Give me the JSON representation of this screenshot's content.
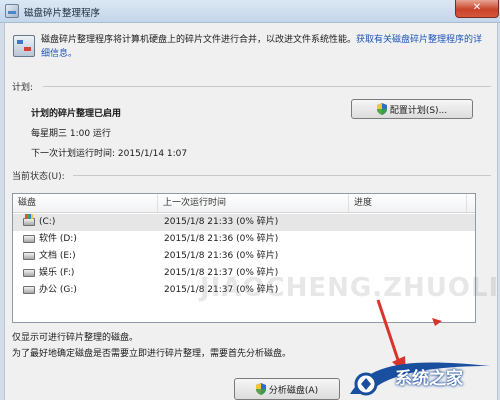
{
  "window": {
    "title": "磁盘碎片整理程序",
    "close_glyph": "✕"
  },
  "description": {
    "text": "磁盘碎片整理程序将计算机硬盘上的碎片文件进行合并，以改进文件系统性能。",
    "link_text": "获取有关磁盘碎片整理程序的详细信息。"
  },
  "schedule": {
    "section_label": "计划:",
    "status": "计划的碎片整理已启用",
    "run_time": "每星期三  1:00 运行",
    "next_run": "下一次计划运行时间: 2015/1/14 1:07",
    "configure_button": "配置计划(S)..."
  },
  "current_status": {
    "section_label": "当前状态(U):",
    "columns": [
      "磁盘",
      "上一次运行时间",
      "进度"
    ],
    "rows": [
      {
        "disk": "(C:)",
        "last_run": "2015/1/8 21:33 (0% 碎片)",
        "progress": "",
        "icon": "system-drive-icon"
      },
      {
        "disk": "软件 (D:)",
        "last_run": "2015/1/8 21:36 (0% 碎片)",
        "progress": "",
        "icon": "drive-icon"
      },
      {
        "disk": "文档 (E:)",
        "last_run": "2015/1/8 21:36 (0% 碎片)",
        "progress": "",
        "icon": "drive-icon"
      },
      {
        "disk": "娱乐 (F:)",
        "last_run": "2015/1/8 21:37 (0% 碎片)",
        "progress": "",
        "icon": "drive-icon"
      },
      {
        "disk": "办公 (G:)",
        "last_run": "2015/1/8 21:37 (0% 碎片)",
        "progress": "",
        "icon": "drive-icon"
      }
    ]
  },
  "footer": {
    "note1": "仅显示可进行碎片整理的磁盘。",
    "note2": "为了最好地确定磁盘是否需要立即进行碎片整理，需要首先分析磁盘。",
    "analyze_button": "分析磁盘(A)"
  },
  "overlay": {
    "watermark": "JIAOCHENG.ZHUOLIAN.COM",
    "brand": "系统之家"
  },
  "colors": {
    "link": "#1c55b9",
    "close_button": "#c8442b",
    "annotation_arrow": "#d9342b",
    "brand_blue": "#1a4f9f"
  }
}
